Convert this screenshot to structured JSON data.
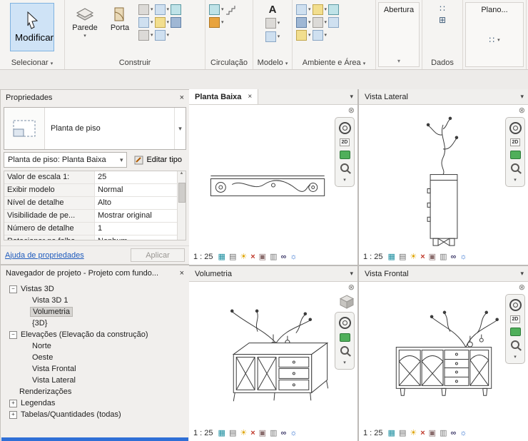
{
  "icons": {
    "close": "×",
    "dropdown": "▾",
    "circle_close": "⊗",
    "minus": "−",
    "plus": "+",
    "sun": "☀",
    "detail": "▦",
    "style": "▤",
    "shadow_x": "×",
    "crop": "▣",
    "crop_vis": "▥",
    "glasses": "∞",
    "reveal": "☼",
    "grid": "⊞",
    "dots": "∷",
    "badge_2d": "2D",
    "letter_a": "A",
    "arrow_up": "▲",
    "arrow_down": "▼"
  },
  "colors": {
    "modify_highlight": "#cfe3f6",
    "selection_blue": "#2f6fd6",
    "link_blue": "#1f5bbd"
  },
  "ribbon": {
    "modify": "Modificar",
    "select": "Selecionar",
    "wall": "Parede",
    "door": "Porta",
    "build": "Construir",
    "circulation": "Circulação",
    "model": "Modelo",
    "area": "Ambiente e Área",
    "opening": "Abertura",
    "data": "Dados",
    "plan": "Plano..."
  },
  "properties": {
    "title": "Propriedades",
    "type_name": "Planta de piso",
    "instance_selector": "Planta de piso: Planta Baixa",
    "edit_type": "Editar tipo",
    "rows": [
      {
        "label": "Valor de escala 1:",
        "value": "25"
      },
      {
        "label": "Exibir modelo",
        "value": "Normal"
      },
      {
        "label": "Nível de detalhe",
        "value": "Alto"
      },
      {
        "label": "Visibilidade de pe...",
        "value": "Mostrar original"
      },
      {
        "label": "Número de detalhe",
        "value": "1"
      },
      {
        "label": "Rotacionar na folha",
        "value": "Nenhum"
      }
    ],
    "help": "Ajuda de propriedades",
    "apply": "Aplicar"
  },
  "browser": {
    "title": "Navegador de projeto - Projeto com fundo...",
    "tree": [
      {
        "label": "Vistas 3D",
        "expander": "−"
      },
      {
        "label": "Vista 3D 1"
      },
      {
        "label": "Volumetria"
      },
      {
        "label": "{3D}"
      },
      {
        "label": "Elevações (Elevação da construção)",
        "expander": "−"
      },
      {
        "label": "Norte"
      },
      {
        "label": "Oeste"
      },
      {
        "label": "Vista Frontal"
      },
      {
        "label": "Vista Lateral"
      },
      {
        "label": "Renderizações"
      },
      {
        "label": "Legendas",
        "expander": "+"
      },
      {
        "label": "Tabelas/Quantidades (todas)",
        "expander": "+"
      }
    ]
  },
  "viewports": [
    {
      "title": "Planta Baixa",
      "scale": "1 : 25"
    },
    {
      "title": "Vista Lateral",
      "scale": "1 : 25"
    },
    {
      "title": "Volumetria",
      "scale": "1 : 25"
    },
    {
      "title": "Vista Frontal",
      "scale": "1 : 25"
    }
  ]
}
